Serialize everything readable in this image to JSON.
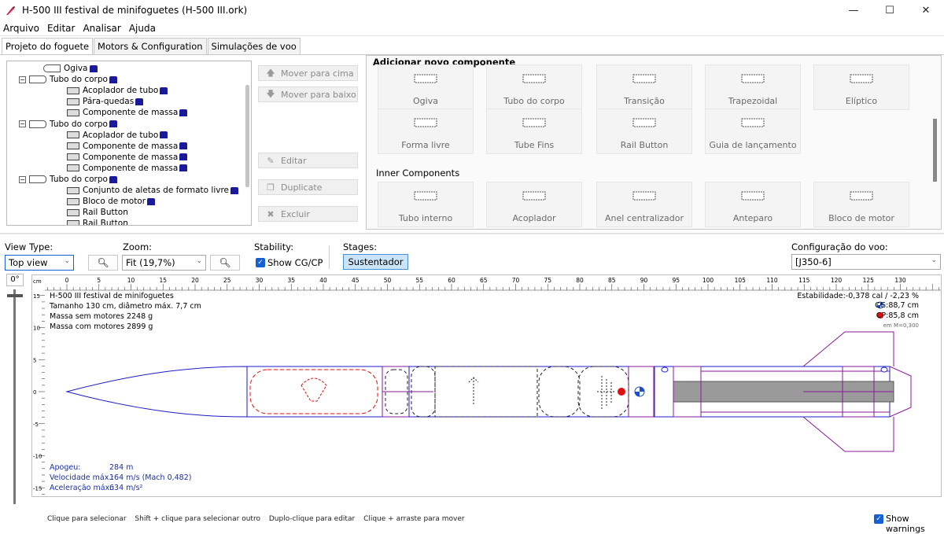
{
  "window": {
    "title": "H-500 III festival de minifoguetes  (H-500 III.ork)",
    "minimize": "—",
    "maximize": "☐",
    "close": "✕"
  },
  "menu": [
    "Arquivo",
    "Editar",
    "Analisar",
    "Ajuda"
  ],
  "tabs": [
    "Projeto do foguete",
    "Motors & Configuration",
    "Simulações de voo"
  ],
  "tree": {
    "items": [
      {
        "label": "Ogiva",
        "level": 1,
        "expand": ""
      },
      {
        "label": "Tubo do corpo",
        "level": 1,
        "expand": "−"
      },
      {
        "label": "Acoplador de tubo",
        "level": 2,
        "expand": ""
      },
      {
        "label": "Pára-quedas",
        "level": 2,
        "expand": ""
      },
      {
        "label": "Componente de massa",
        "level": 2,
        "expand": ""
      },
      {
        "label": "Tubo do corpo",
        "level": 1,
        "expand": "−"
      },
      {
        "label": "Acoplador de tubo",
        "level": 2,
        "expand": ""
      },
      {
        "label": "Componente de massa",
        "level": 2,
        "expand": ""
      },
      {
        "label": "Componente de massa",
        "level": 2,
        "expand": ""
      },
      {
        "label": "Componente de massa",
        "level": 2,
        "expand": ""
      },
      {
        "label": "Tubo do corpo",
        "level": 1,
        "expand": "−"
      },
      {
        "label": "Conjunto de aletas de formato livre",
        "level": 2,
        "expand": ""
      },
      {
        "label": "Bloco de motor",
        "level": 2,
        "expand": ""
      },
      {
        "label": "Rail Button",
        "level": 2,
        "expand": ""
      },
      {
        "label": "Rail Button",
        "level": 2,
        "expand": ""
      }
    ]
  },
  "side_buttons": {
    "move_up": "Mover para cima",
    "move_down": "Mover para baixo",
    "edit": "Editar",
    "duplicate": "Duplicate",
    "delete": "Excluir"
  },
  "add_panel": {
    "header": "Adicionar novo componente",
    "body_components": [
      "Ogiva",
      "Tubo do corpo",
      "Transição",
      "Trapezoidal",
      "Elíptico",
      "Forma livre",
      "Tube Fins",
      "Rail Button",
      "Guia de lançamento"
    ],
    "inner_header": "Inner Components",
    "inner_components": [
      "Tubo interno",
      "Acoplador",
      "Anel centralizador",
      "Anteparo",
      "Bloco de motor"
    ]
  },
  "controls": {
    "view_type_label": "View Type:",
    "view_type_value": "Top view",
    "zoom_label": "Zoom:",
    "zoom_value": "Fit (19,7%)",
    "stability_label": "Stability:",
    "show_cgcp": "Show CG/CP",
    "stages_label": "Stages:",
    "stage_button": "Sustentador",
    "config_label": "Configuração do voo:",
    "config_value": "[J350-6]",
    "rotation": "0°"
  },
  "ruler": {
    "unit": "cm",
    "x_ticks": [
      "0",
      "5",
      "10",
      "15",
      "20",
      "25",
      "30",
      "35",
      "40",
      "45",
      "50",
      "55",
      "60",
      "65",
      "70",
      "75",
      "80",
      "85",
      "90",
      "95",
      "100",
      "105",
      "110",
      "115",
      "120",
      "125",
      "130"
    ],
    "y_ticks": [
      "15",
      "10",
      "5",
      "0",
      "-5",
      "-10",
      "-15"
    ]
  },
  "rocket_info": {
    "name": "H-500 III festival de minifoguetes",
    "size": "Tamanho 130 cm, diâmetro máx. 7,7 cm",
    "mass_no_motor": "Massa sem motores 2248 g",
    "mass_with_motor": "Massa com motores 2899 g",
    "stability": "Estabilidade:-0,378 cal / -2,23 %",
    "cg": "CG:88,7 cm",
    "cp": "CP:85,8 cm",
    "mach": "em M=0,300"
  },
  "flight": {
    "apogee_label": "Apogeu:",
    "apogee_value": "284 m",
    "velocity_label": "Velocidade máx.:",
    "velocity_value": "164 m/s  (Mach 0,482)",
    "accel_label": "Aceleração máx.:",
    "accel_value": "634 m/s²"
  },
  "footer": {
    "hints": [
      "Clique para selecionar",
      "Shift + clique para selecionar outro",
      "Duplo-clique para editar",
      "Clique + arraste para mover"
    ],
    "show_warnings": "Show warnings"
  },
  "colors": {
    "accent": "#1461d4",
    "body_outline": "#1c1cc8",
    "fin_outline": "#8b1a9b",
    "cp": "#e01010",
    "cg": "#1c50c8"
  }
}
